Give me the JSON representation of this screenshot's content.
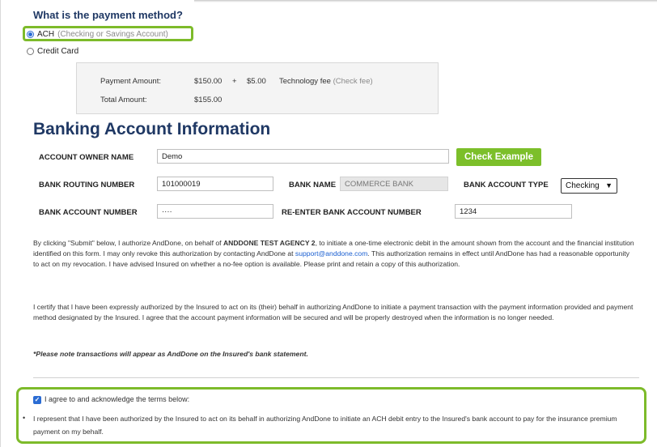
{
  "payment_method": {
    "title": "What is the payment method?",
    "options": [
      {
        "label": "ACH",
        "hint": "(Checking or Savings Account)",
        "selected": true
      },
      {
        "label": "Credit Card",
        "selected": false
      }
    ]
  },
  "amounts": {
    "payment_label": "Payment Amount:",
    "payment_value": "$150.00",
    "plus": "+",
    "fee_value": "$5.00",
    "fee_label": "Technology fee",
    "fee_hint": "(Check fee)",
    "total_label": "Total Amount:",
    "total_value": "$155.00"
  },
  "banking": {
    "title": "Banking Account Information",
    "owner_label": "ACCOUNT OWNER NAME",
    "owner_value": "Demo",
    "check_example": "Check Example",
    "routing_label": "BANK ROUTING NUMBER",
    "routing_value": "101000019",
    "bank_name_label": "BANK NAME",
    "bank_name_value": "COMMERCE BANK",
    "account_type_label": "BANK ACCOUNT TYPE",
    "account_type_value": "Checking",
    "account_number_label": "BANK ACCOUNT NUMBER",
    "account_number_value": "····",
    "reenter_label": "RE-ENTER BANK ACCOUNT NUMBER",
    "reenter_value": "1234"
  },
  "legal": {
    "p1_a": "By clicking \"Submit\" below, I authorize AndDone, on behalf of ",
    "p1_agency": "ANDDONE TEST AGENCY 2",
    "p1_b": ", to initiate a one-time electronic debit in the amount shown from the account and the financial institution identified on this form. I may only revoke this authorization by contacting AndDone at ",
    "p1_email": "support@anddone.com",
    "p1_c": ". This authorization remains in effect until AndDone has had a reasonable opportunity to act on my revocation. I have advised Insured on whether a no-fee option is available. Please print and retain a copy of this authorization.",
    "p2": "I certify that I have been expressly authorized by the Insured to act on its (their) behalf in authorizing AndDone to initiate a payment transaction with the payment information provided and payment method designated by the Insured. I agree that the account payment information will be secured and will be properly destroyed when the information is no longer needed.",
    "note": "*Please note transactions will appear as AndDone on the Insured's bank statement."
  },
  "agreement": {
    "checkbox_label": "I agree to and acknowledge the terms below:",
    "bullet": "•",
    "text": "I represent that I have been authorized by the Insured to act on its behalf in authorizing AndDone to initiate an ACH debit entry to the Insured's bank account to pay for the insurance premium payment on my behalf."
  }
}
